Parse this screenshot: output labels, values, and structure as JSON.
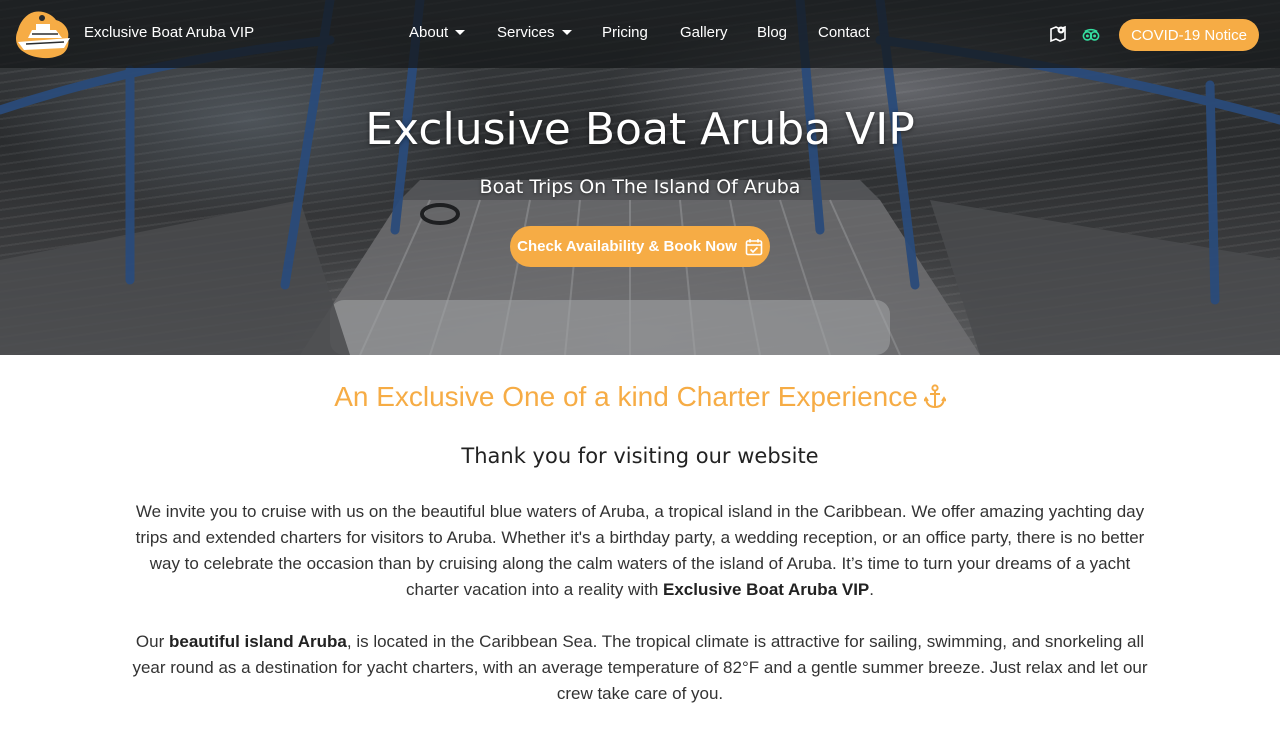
{
  "header": {
    "site_name": "Exclusive Boat Aruba VIP",
    "nav": [
      {
        "label": "About",
        "has_dropdown": true
      },
      {
        "label": "Services",
        "has_dropdown": true
      },
      {
        "label": "Pricing",
        "has_dropdown": false
      },
      {
        "label": "Gallery",
        "has_dropdown": false
      },
      {
        "label": "Blog",
        "has_dropdown": false
      },
      {
        "label": "Contact",
        "has_dropdown": false
      }
    ],
    "icons": [
      "map-pin-icon",
      "tripadvisor-icon"
    ],
    "covid_button": "COVID-19 Notice"
  },
  "hero": {
    "title": "Exclusive Boat Aruba VIP",
    "subtitle": "Boat Trips On The Island Of Aruba",
    "cta_label": "Check Availability & Book Now",
    "cta_icon": "calendar-check-icon"
  },
  "content": {
    "tagline": "An Exclusive One of a kind Charter Experience",
    "tagline_icon": "anchor-icon",
    "thanks_heading": "Thank you for visiting our website",
    "para1": {
      "text": "We invite you to cruise with us on the beautiful blue waters of Aruba, a tropical island in the Caribbean. We offer amazing yachting day trips and extended charters for visitors to Aruba. Whether it's a birthday party, a wedding reception, or an office party, there is no better way to celebrate the occasion than by cruising along the calm waters of the island of Aruba. It’s time to turn your dreams of a yacht charter vacation into a reality with ",
      "bold": "Exclusive Boat Aruba VIP",
      "end": "."
    },
    "para2": {
      "start": "Our ",
      "bold": "beautiful island Aruba",
      "text": ", is located in the Caribbean Sea. The tropical climate is attractive for sailing, swimming, and snorkeling all year round as a destination for yacht charters, with an average temperature of 82°F and a gentle summer breeze. Just relax and let our crew take care of you."
    }
  },
  "colors": {
    "accent": "#f6ac45",
    "nav_bg": "#141618",
    "text": "#333333",
    "tripadvisor": "#34e0a1"
  }
}
